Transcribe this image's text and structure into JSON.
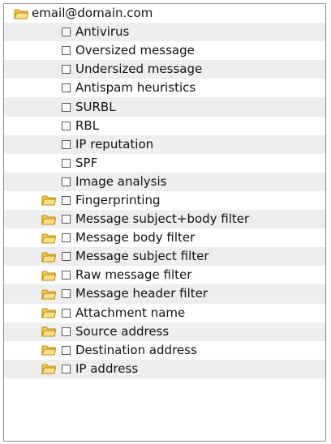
{
  "root": {
    "label": "email@domain.com",
    "icon": "folder-icon"
  },
  "items": [
    {
      "label": "Antivirus",
      "has_folder": false,
      "checked": false
    },
    {
      "label": "Oversized message",
      "has_folder": false,
      "checked": false
    },
    {
      "label": "Undersized message",
      "has_folder": false,
      "checked": false
    },
    {
      "label": "Antispam heuristics",
      "has_folder": false,
      "checked": false
    },
    {
      "label": "SURBL",
      "has_folder": false,
      "checked": false
    },
    {
      "label": "RBL",
      "has_folder": false,
      "checked": false
    },
    {
      "label": "IP reputation",
      "has_folder": false,
      "checked": false
    },
    {
      "label": "SPF",
      "has_folder": false,
      "checked": false
    },
    {
      "label": "Image analysis",
      "has_folder": false,
      "checked": false
    },
    {
      "label": "Fingerprinting",
      "has_folder": true,
      "checked": false
    },
    {
      "label": "Message subject+body filter",
      "has_folder": true,
      "checked": false
    },
    {
      "label": "Message body filter",
      "has_folder": true,
      "checked": false
    },
    {
      "label": "Message subject filter",
      "has_folder": true,
      "checked": false
    },
    {
      "label": "Raw message filter",
      "has_folder": true,
      "checked": false
    },
    {
      "label": "Message header filter",
      "has_folder": true,
      "checked": false
    },
    {
      "label": "Attachment name",
      "has_folder": true,
      "checked": false
    },
    {
      "label": "Source address",
      "has_folder": true,
      "checked": false
    },
    {
      "label": "Destination address",
      "has_folder": true,
      "checked": false
    },
    {
      "label": "IP address",
      "has_folder": true,
      "checked": false
    }
  ],
  "colors": {
    "folder_fill": "#f6cf4e",
    "folder_stroke": "#b8860b",
    "row_alt": "#eeeeee",
    "border": "#8c8c8c"
  }
}
